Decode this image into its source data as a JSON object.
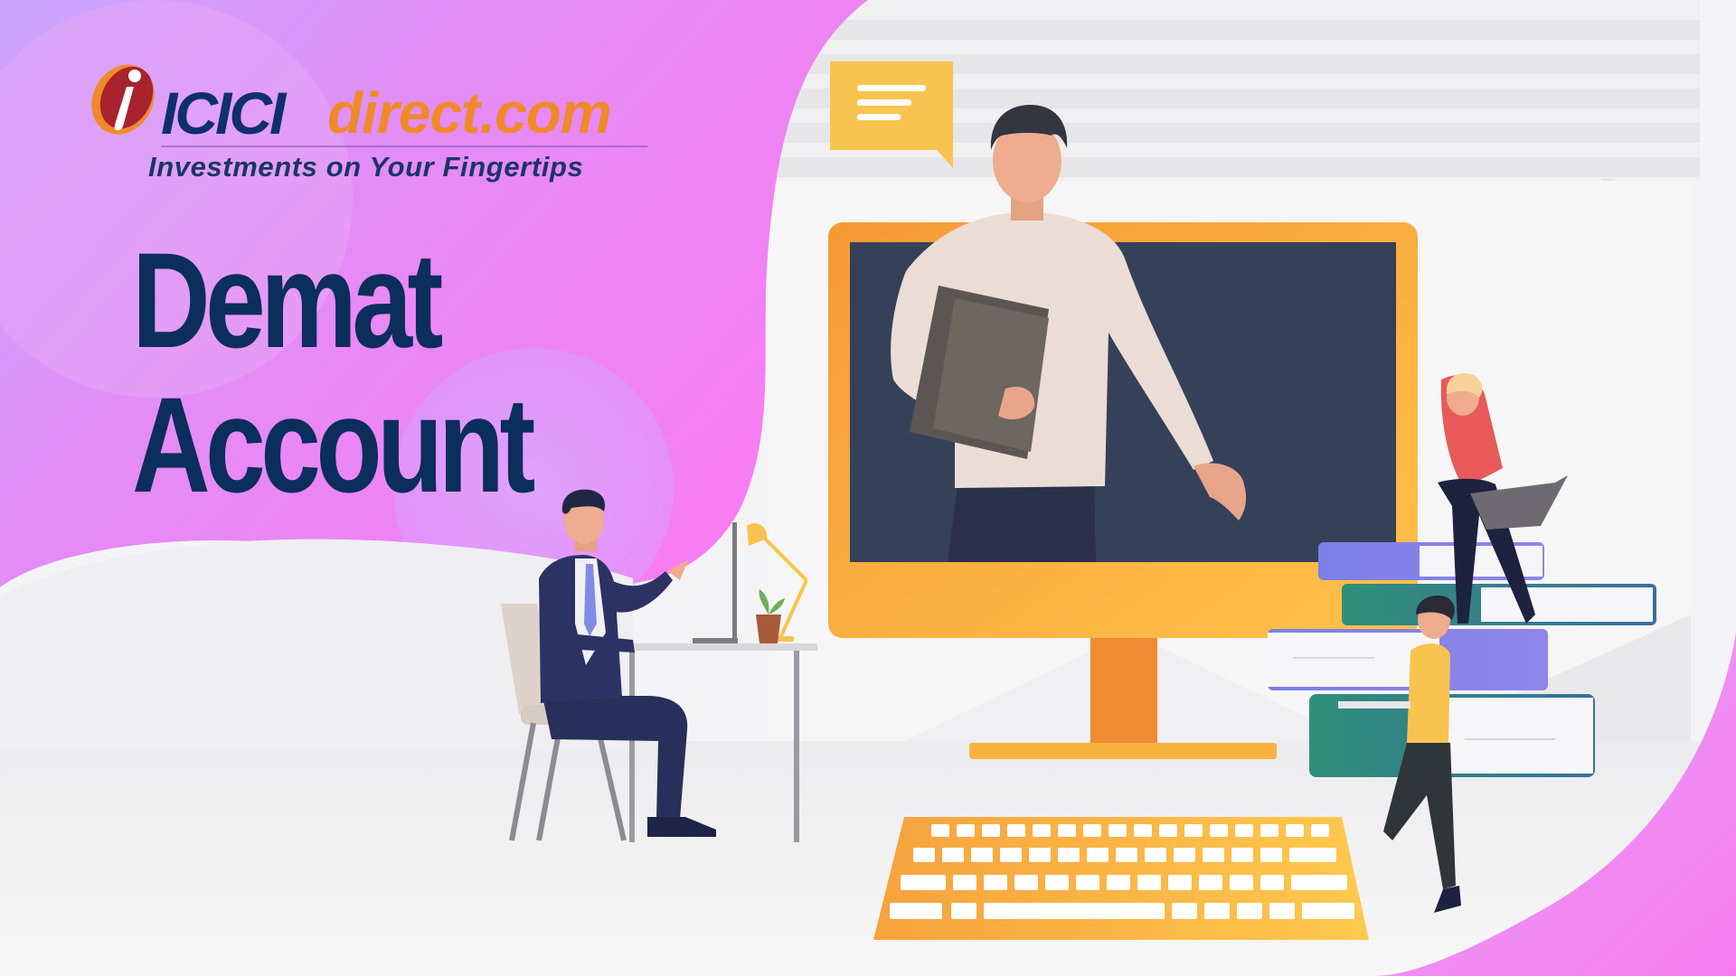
{
  "brand": {
    "name_part1": "ICICI",
    "name_part2": "direct.com",
    "tagline": "Investments on Your Fingertips"
  },
  "headline": {
    "line1": "Demat",
    "line2": "Account"
  },
  "colors": {
    "navy": "#0b2e5c",
    "brand_orange": "#ef8a2b",
    "magenta": "#f27ef4",
    "monitor_frame": "#f7a93a",
    "monitor_screen": "#344059"
  },
  "illustration": {
    "elements": [
      "chat-bubble-icon",
      "monitor",
      "presenter-figure",
      "keyboard",
      "desk",
      "office-chair",
      "businessman-figure",
      "desk-lamp",
      "plant-pot",
      "book-stack",
      "woman-with-laptop",
      "window-blinds"
    ]
  }
}
